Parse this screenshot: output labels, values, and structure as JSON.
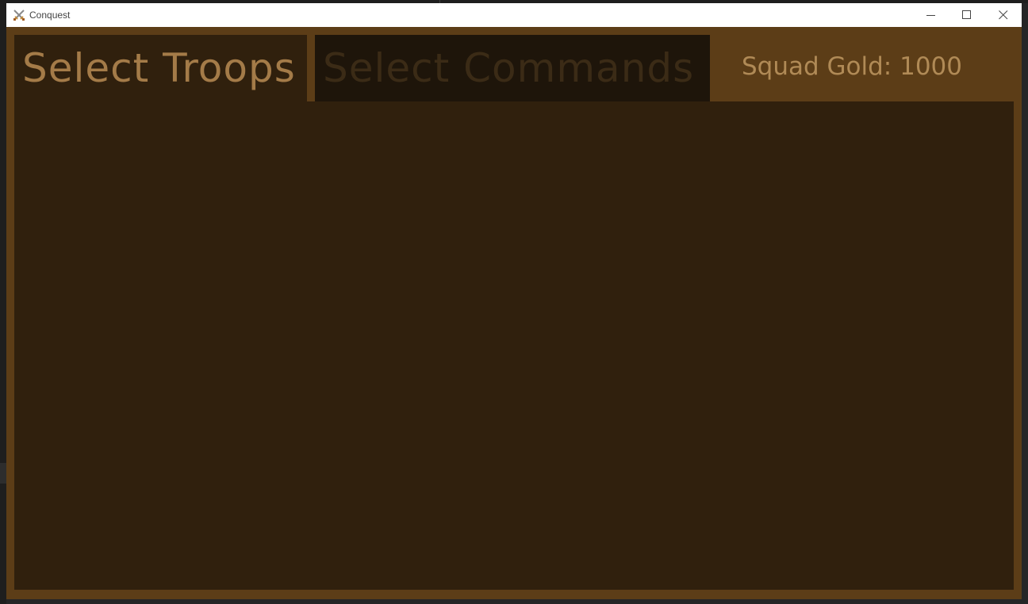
{
  "window": {
    "title": "Conquest",
    "icon": "crossed-swords-icon"
  },
  "controls": {
    "minimize_icon": "minimize-icon",
    "maximize_icon": "maximize-icon",
    "close_icon": "close-icon"
  },
  "tabs": [
    {
      "label": "Select Troops",
      "active": true
    },
    {
      "label": "Select Commands",
      "active": false
    }
  ],
  "squad_gold": "Squad Gold: 1000",
  "colors": {
    "frame": "#5c3d17",
    "panel": "#30200d",
    "inactive_tab": "#1e150a",
    "active_text": "#a47b48",
    "inactive_text": "#3b2b16",
    "gold_text": "#b08a56"
  }
}
